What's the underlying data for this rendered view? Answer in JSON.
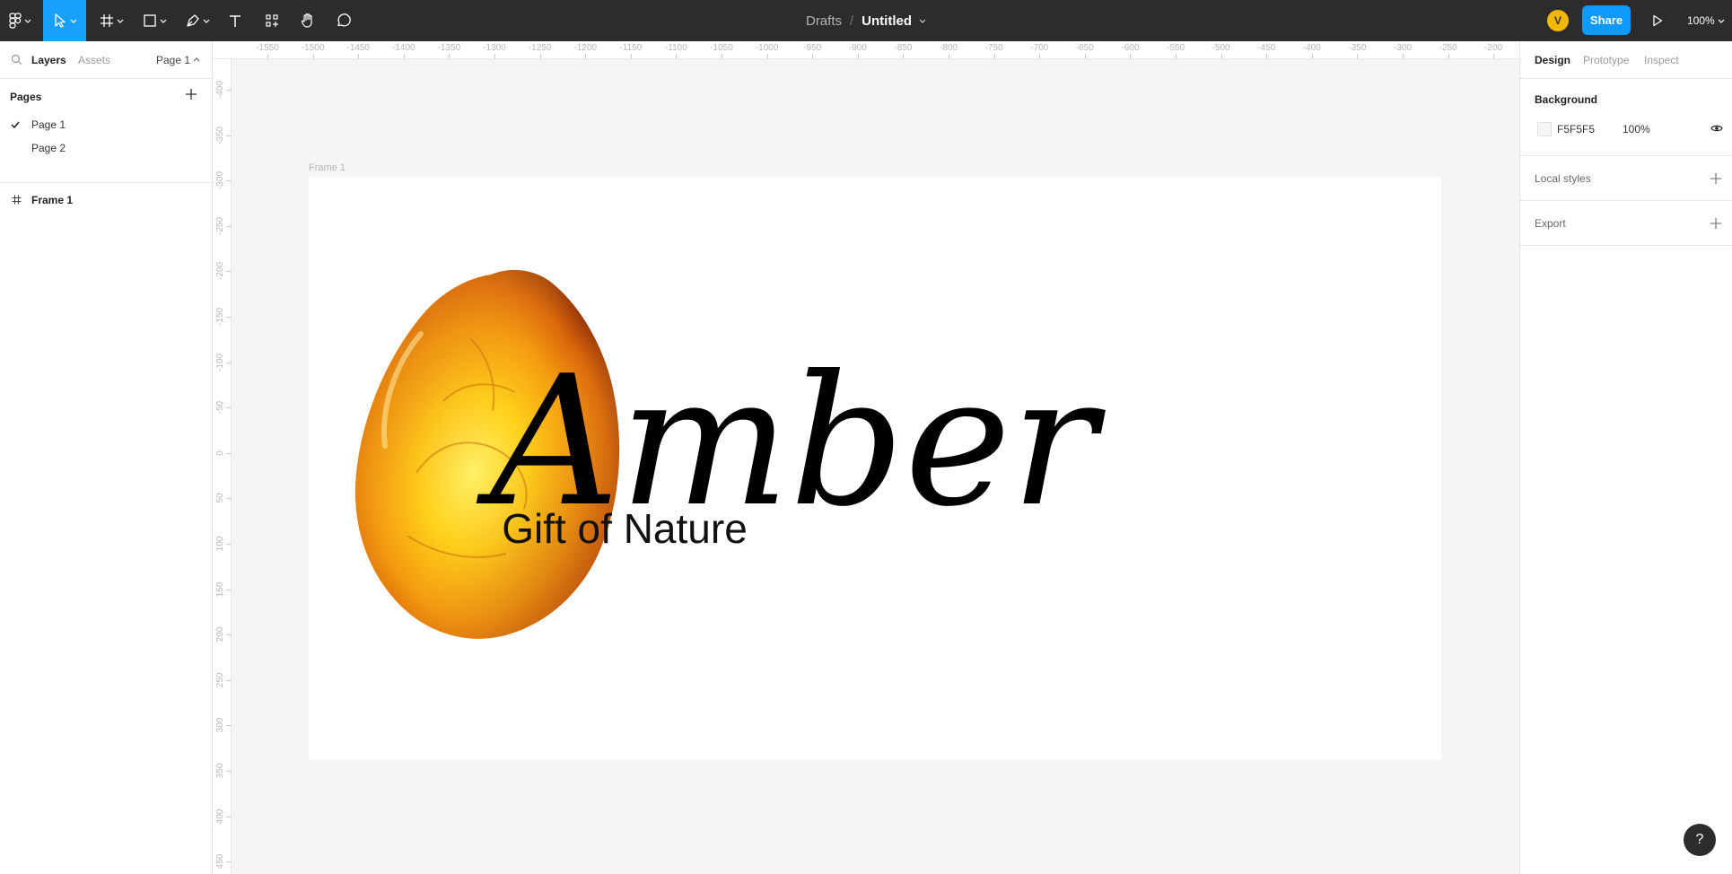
{
  "toolbar": {
    "tools": [
      {
        "name": "main-menu",
        "icon": "figma-logo-icon"
      },
      {
        "name": "move-tool",
        "icon": "cursor-arrow-icon",
        "active": true
      },
      {
        "name": "frame-tool",
        "icon": "hash-frame-icon"
      },
      {
        "name": "shape-tool",
        "icon": "rectangle-icon"
      },
      {
        "name": "pen-tool",
        "icon": "pen-nib-icon"
      },
      {
        "name": "text-tool",
        "icon": "text-t-icon"
      },
      {
        "name": "resources-tool",
        "icon": "components-icon"
      },
      {
        "name": "hand-tool",
        "icon": "hand-icon"
      },
      {
        "name": "comment-tool",
        "icon": "speech-bubble-icon"
      }
    ],
    "breadcrumb": "Drafts",
    "separator": "/",
    "file_name": "Untitled",
    "avatar_initial": "V",
    "share_label": "Share",
    "zoom": "100%",
    "accent": "#18a0fb"
  },
  "left_panel": {
    "tabs": {
      "layers": "Layers",
      "assets": "Assets"
    },
    "current_page": "Page 1",
    "pages_title": "Pages",
    "pages": [
      {
        "label": "Page 1",
        "selected": true
      },
      {
        "label": "Page 2",
        "selected": false
      }
    ],
    "layers": [
      {
        "label": "Frame 1",
        "icon": "frame-hash-icon"
      }
    ]
  },
  "rulers": {
    "horizontal": [
      "-1550",
      "-1500",
      "-1450",
      "-1400",
      "-1350",
      "-1300",
      "-1250",
      "-1200",
      "-1150",
      "-1100",
      "-1050",
      "-1000",
      "-950",
      "-900",
      "-850",
      "-800",
      "-750",
      "-700",
      "-650",
      "-600",
      "-550",
      "-500",
      "-450",
      "-400",
      "-350",
      "-300",
      "-250",
      "-200"
    ],
    "vertical": [
      "-400",
      "-350",
      "-300",
      "-250",
      "-200",
      "-150",
      "-100",
      "-50",
      "0",
      "50",
      "100",
      "150",
      "200",
      "250",
      "300",
      "350",
      "400",
      "450"
    ]
  },
  "canvas": {
    "frame_label": "Frame 1",
    "logo_title": "Amber",
    "logo_tagline": "Gift of Nature",
    "background": "#f5f5f5"
  },
  "right_panel": {
    "tabs": {
      "design": "Design",
      "prototype": "Prototype",
      "inspect": "Inspect"
    },
    "background": {
      "title": "Background",
      "hex": "F5F5F5",
      "opacity": "100%"
    },
    "local_styles": "Local styles",
    "export": "Export"
  },
  "help_label": "?"
}
